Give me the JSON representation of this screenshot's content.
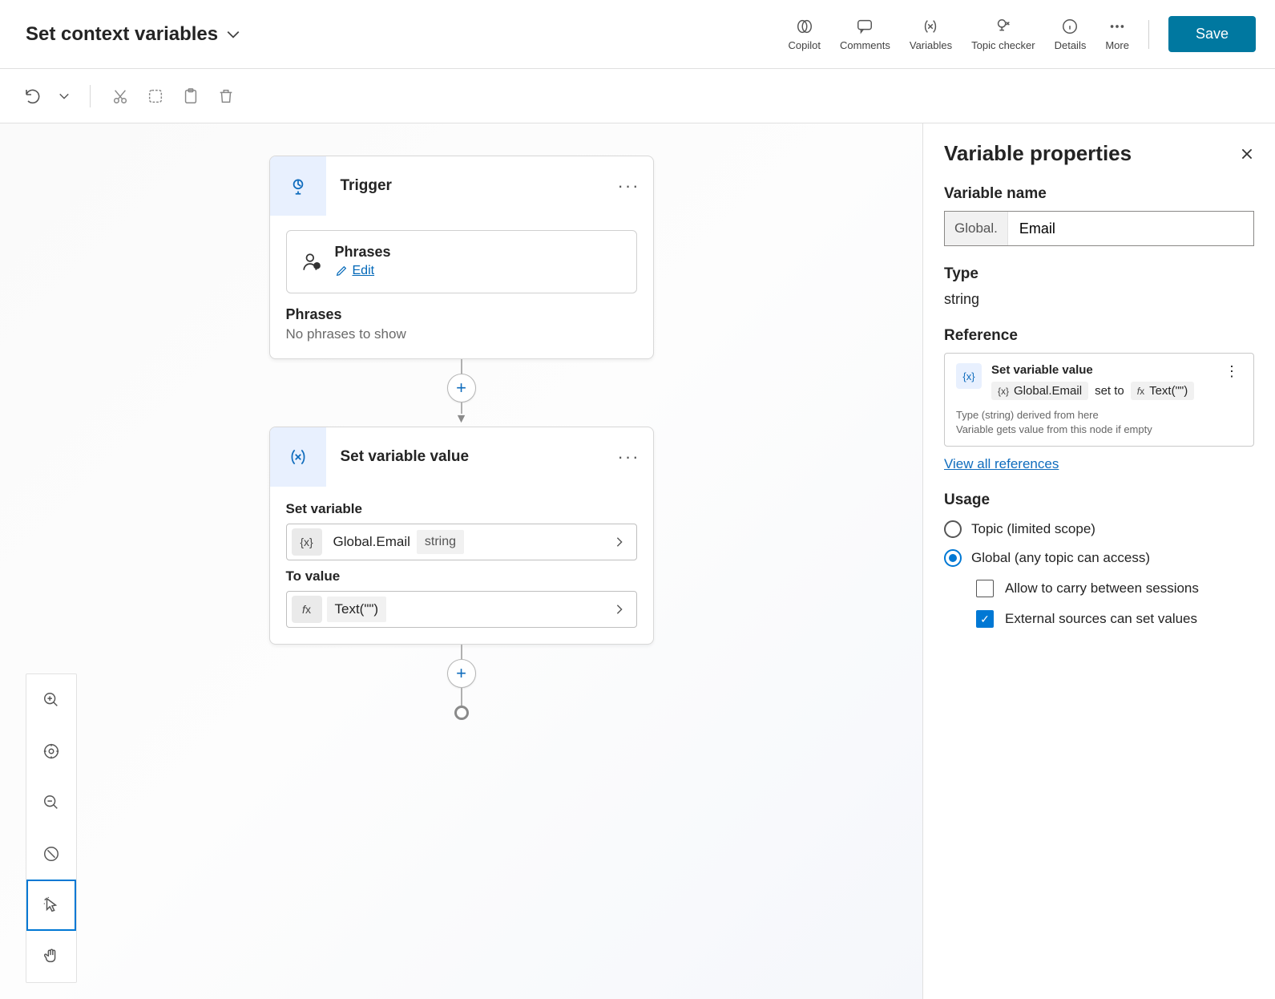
{
  "header": {
    "title": "Set context variables",
    "items": {
      "copilot": "Copilot",
      "comments": "Comments",
      "variables": "Variables",
      "topic_checker": "Topic checker",
      "details": "Details",
      "more": "More"
    },
    "save": "Save"
  },
  "canvas": {
    "trigger": {
      "title": "Trigger",
      "phrases_box_title": "Phrases",
      "edit": "Edit",
      "phrases_label": "Phrases",
      "phrases_empty": "No phrases to show"
    },
    "setvar": {
      "title": "Set variable value",
      "set_variable_label": "Set variable",
      "var_name": "Global.Email",
      "var_type": "string",
      "to_value_label": "To value",
      "to_value": "Text(\"\")"
    }
  },
  "panel": {
    "title": "Variable properties",
    "var_name_label": "Variable name",
    "var_prefix": "Global.",
    "var_name_value": "Email",
    "type_label": "Type",
    "type_value": "string",
    "reference_label": "Reference",
    "ref_title": "Set variable value",
    "ref_var": "Global.Email",
    "ref_setto": "set to",
    "ref_expr": "Text(\"\")",
    "ref_note1": "Type (string) derived from here",
    "ref_note2": "Variable gets value from this node if empty",
    "view_refs": "View all references",
    "usage_label": "Usage",
    "usage_topic": "Topic (limited scope)",
    "usage_global": "Global (any topic can access)",
    "carry": "Allow to carry between sessions",
    "external": "External sources can set values"
  }
}
